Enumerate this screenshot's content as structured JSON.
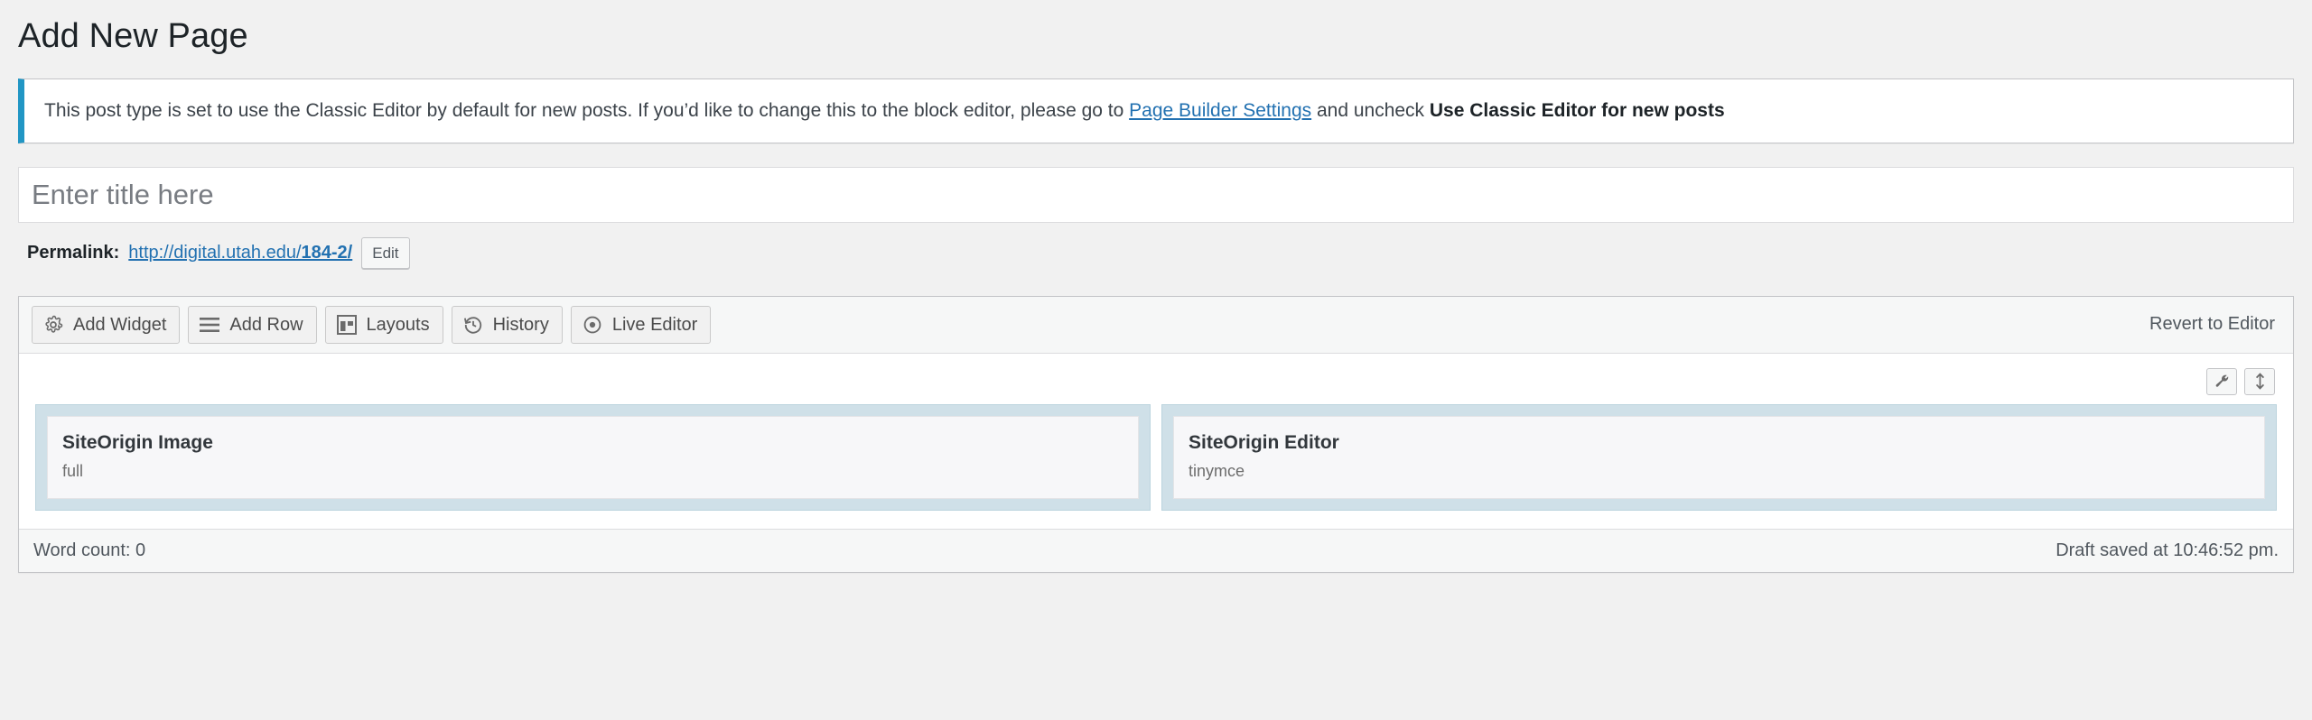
{
  "page": {
    "title": "Add New Page"
  },
  "notice": {
    "text_before_link": "This post type is set to use the Classic Editor by default for new posts. If you’d like to change this to the block editor, please go to ",
    "link_label": "Page Builder Settings",
    "text_after_link": " and uncheck ",
    "bold_tail": "Use Classic Editor for new posts",
    "accent_color": "#2196c4"
  },
  "title_field": {
    "value": "",
    "placeholder": "Enter title here"
  },
  "permalink": {
    "label": "Permalink:",
    "base": "http://digital.utah.edu/",
    "slug": "184-2/",
    "edit_label": "Edit",
    "link_color": "#2271b1"
  },
  "page_builder": {
    "toolbar": {
      "buttons": [
        {
          "label": "Add Widget",
          "icon": "gear-icon"
        },
        {
          "label": "Add Row",
          "icon": "hamburger-icon"
        },
        {
          "label": "Layouts",
          "icon": "layout-grid-icon"
        },
        {
          "label": "History",
          "icon": "history-clock-icon"
        },
        {
          "label": "Live Editor",
          "icon": "eye-icon"
        }
      ],
      "revert_label": "Revert to Editor"
    },
    "row_tools": [
      {
        "icon": "wrench-icon",
        "name": "row-settings"
      },
      {
        "icon": "move-vertical-icon",
        "name": "row-move"
      }
    ],
    "cells": [
      {
        "title": "SiteOrigin Image",
        "subtitle": "full"
      },
      {
        "title": "SiteOrigin Editor",
        "subtitle": "tinymce"
      }
    ],
    "cell_color": "#cfe0e8"
  },
  "footer": {
    "word_count": "Word count: 0",
    "draft_status": "Draft saved at 10:46:52 pm."
  }
}
